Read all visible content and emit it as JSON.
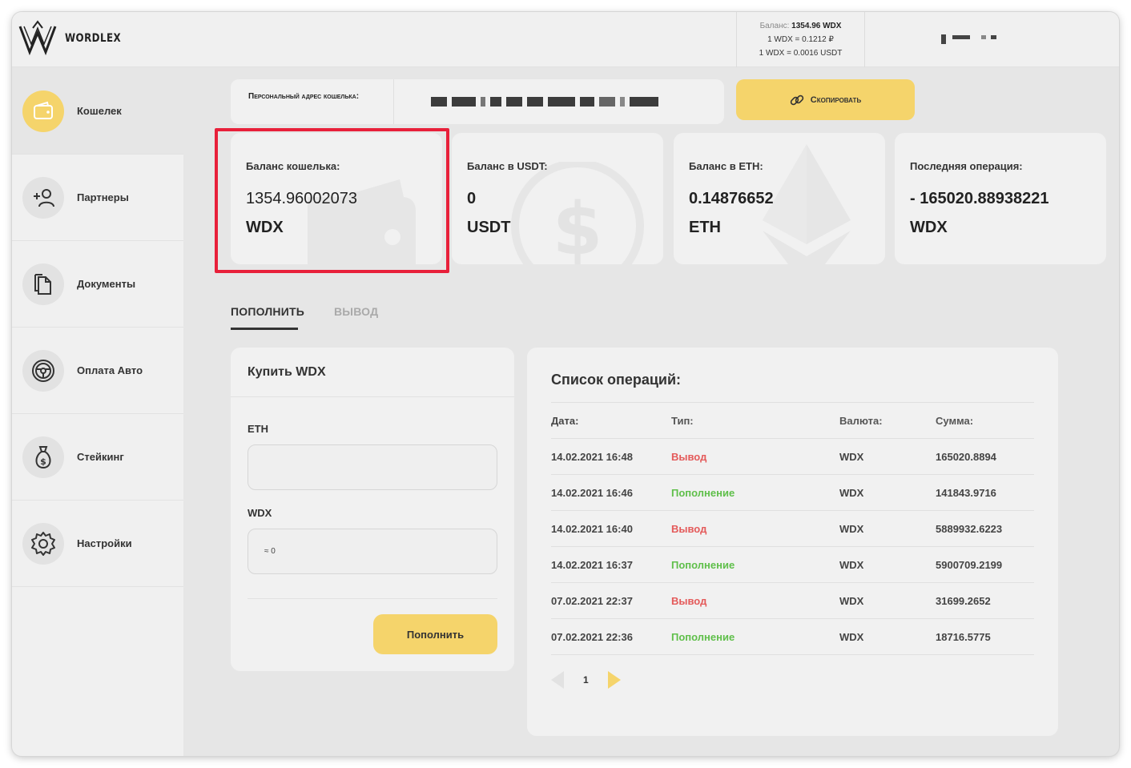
{
  "brand": {
    "name": "WORDLEX"
  },
  "header": {
    "balance_label": "Баланс:",
    "balance_value": "1354.96 WDX",
    "rate_rub": "1 WDX = 0.1212 ₽",
    "rate_usdt": "1 WDX = 0.0016 USDT"
  },
  "sidebar": {
    "items": [
      {
        "label": "Кошелек",
        "icon": "wallet-icon",
        "active": true
      },
      {
        "label": "Партнеры",
        "icon": "add-user-icon",
        "active": false
      },
      {
        "label": "Документы",
        "icon": "documents-icon",
        "active": false
      },
      {
        "label": "Оплата Авто",
        "icon": "steering-wheel-icon",
        "active": false
      },
      {
        "label": "Стейкинг",
        "icon": "money-bag-icon",
        "active": false
      },
      {
        "label": "Настройки",
        "icon": "gear-icon",
        "active": false
      }
    ]
  },
  "address": {
    "label": "Персональный адрес кошелька:",
    "copy_label": "Скопировать"
  },
  "cards": [
    {
      "title": "Баланс кошелька:",
      "value": "1354.96002073",
      "unit": "WDX"
    },
    {
      "title": "Баланс в USDT:",
      "value": "0",
      "unit": "USDT"
    },
    {
      "title": "Баланс в ETH:",
      "value": "0.14876652",
      "unit": "ETH"
    },
    {
      "title": "Последняя операция:",
      "value": "- 165020.88938221",
      "unit": "WDX"
    }
  ],
  "tabs": [
    {
      "label": "ПОПОЛНИТЬ",
      "active": true
    },
    {
      "label": "ВЫВОД",
      "active": false
    }
  ],
  "buy": {
    "title": "Купить WDX",
    "eth_label": "ETH",
    "eth_value": "",
    "wdx_label": "WDX",
    "wdx_value": "≈ 0",
    "submit_label": "Пополнить"
  },
  "operations": {
    "title": "Список операций:",
    "columns": [
      "Дата:",
      "Тип:",
      "Валюта:",
      "Сумма:"
    ],
    "rows": [
      {
        "date": "14.02.2021 16:48",
        "type": "Вывод",
        "kind": "out",
        "currency": "WDX",
        "amount": "165020.8894"
      },
      {
        "date": "14.02.2021 16:46",
        "type": "Пополнение",
        "kind": "in",
        "currency": "WDX",
        "amount": "141843.9716"
      },
      {
        "date": "14.02.2021 16:40",
        "type": "Вывод",
        "kind": "out",
        "currency": "WDX",
        "amount": "5889932.6223"
      },
      {
        "date": "14.02.2021 16:37",
        "type": "Пополнение",
        "kind": "in",
        "currency": "WDX",
        "amount": "5900709.2199"
      },
      {
        "date": "07.02.2021 22:37",
        "type": "Вывод",
        "kind": "out",
        "currency": "WDX",
        "amount": "31699.2652"
      },
      {
        "date": "07.02.2021 22:36",
        "type": "Пополнение",
        "kind": "in",
        "currency": "WDX",
        "amount": "18716.5775"
      }
    ],
    "page": "1"
  },
  "colors": {
    "accent": "#f5d46b",
    "withdraw": "#e45a5a",
    "deposit": "#5fbf4a",
    "highlight": "#e8203a"
  }
}
